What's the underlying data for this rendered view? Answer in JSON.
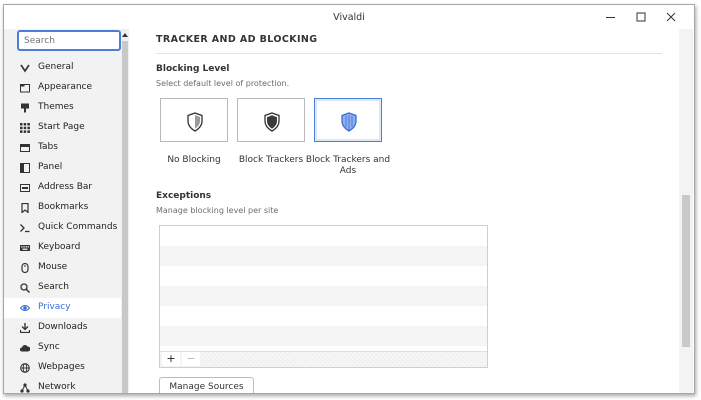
{
  "window": {
    "title": "Vivaldi",
    "minimize_icon": "minimize-icon",
    "maximize_icon": "maximize-icon",
    "close_icon": "close-icon"
  },
  "sidebar": {
    "search": {
      "placeholder": "Search",
      "value": ""
    },
    "items": [
      {
        "label": "General",
        "icon": "chevron-down-icon"
      },
      {
        "label": "Appearance",
        "icon": "folder-icon"
      },
      {
        "label": "Themes",
        "icon": "brush-icon"
      },
      {
        "label": "Start Page",
        "icon": "grid-icon"
      },
      {
        "label": "Tabs",
        "icon": "tabs-icon"
      },
      {
        "label": "Panel",
        "icon": "panel-icon"
      },
      {
        "label": "Address Bar",
        "icon": "address-bar-icon"
      },
      {
        "label": "Bookmarks",
        "icon": "bookmark-icon"
      },
      {
        "label": "Quick Commands",
        "icon": "quick-commands-icon"
      },
      {
        "label": "Keyboard",
        "icon": "keyboard-icon"
      },
      {
        "label": "Mouse",
        "icon": "mouse-icon"
      },
      {
        "label": "Search",
        "icon": "magnifier-icon"
      },
      {
        "label": "Privacy",
        "icon": "eye-icon",
        "active": true
      },
      {
        "label": "Downloads",
        "icon": "download-icon"
      },
      {
        "label": "Sync",
        "icon": "cloud-icon"
      },
      {
        "label": "Webpages",
        "icon": "globe-icon"
      },
      {
        "label": "Network",
        "icon": "network-icon"
      }
    ]
  },
  "content": {
    "section_title": "TRACKER AND AD BLOCKING",
    "blocking": {
      "heading": "Blocking Level",
      "description": "Select default level of protection.",
      "options": [
        {
          "label": "No Blocking",
          "icon": "shield-empty-icon",
          "selected": false
        },
        {
          "label": "Block Trackers",
          "icon": "shield-half-icon",
          "selected": false
        },
        {
          "label": "Block Trackers and Ads",
          "icon": "shield-full-icon",
          "selected": true
        }
      ]
    },
    "exceptions": {
      "heading": "Exceptions",
      "description": "Manage blocking level per site",
      "add_label": "+",
      "remove_label": "−"
    },
    "manage_sources_label": "Manage Sources"
  },
  "colors": {
    "accent": "#3a6fd8",
    "selected_bg": "#dde9fb",
    "sidebar_bg": "#f2f2f2"
  }
}
